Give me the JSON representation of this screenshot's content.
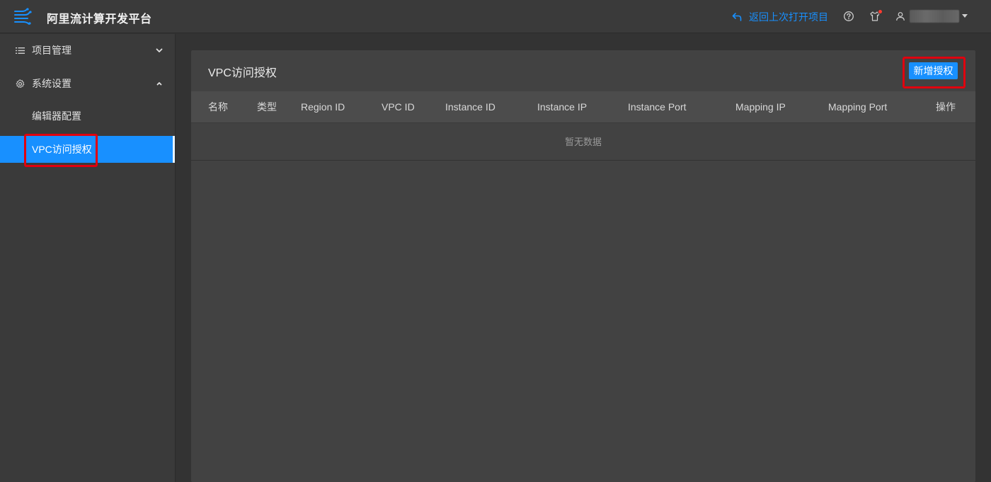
{
  "app": {
    "title": "阿里流计算开发平台",
    "logo_icon": "stream-logo-icon"
  },
  "header": {
    "return_label": "返回上次打开项目",
    "help_icon": "help-circle-icon",
    "notification_icon": "shirt-notification-icon",
    "user_icon": "user-icon",
    "accent_color": "#1890ff"
  },
  "sidebar": {
    "items": [
      {
        "label": "项目管理",
        "icon": "list-icon",
        "expanded": false
      },
      {
        "label": "系统设置",
        "icon": "gear-icon",
        "expanded": true,
        "children": [
          {
            "label": "编辑器配置",
            "active": false
          },
          {
            "label": "VPC访问授权",
            "active": true
          }
        ]
      }
    ]
  },
  "main": {
    "title": "VPC访问授权",
    "add_button_label": "新增授权",
    "table": {
      "columns": [
        "名称",
        "类型",
        "Region ID",
        "VPC ID",
        "Instance ID",
        "Instance IP",
        "Instance Port",
        "Mapping IP",
        "Mapping Port",
        "操作"
      ],
      "rows": [],
      "empty_text": "暂无数据"
    }
  }
}
